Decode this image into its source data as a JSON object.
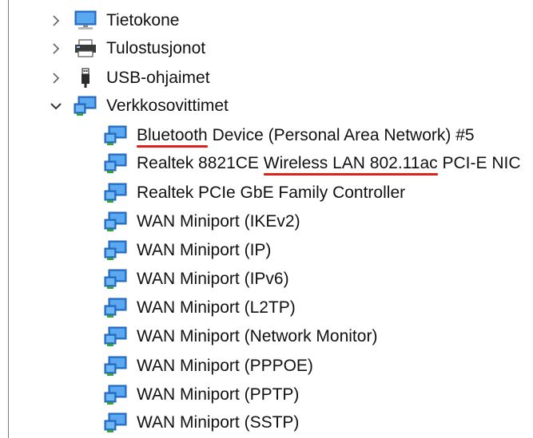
{
  "tree": {
    "categories": [
      {
        "label": "Tietokone",
        "icon": "computer-monitor-icon",
        "expanded": false
      },
      {
        "label": "Tulostusjonot",
        "icon": "printer-icon",
        "expanded": false
      },
      {
        "label": "USB-ohjaimet",
        "icon": "usb-plug-icon",
        "expanded": false
      },
      {
        "label": "Verkkosovittimet",
        "icon": "network-adapter-icon",
        "expanded": true
      }
    ],
    "adapters": [
      {
        "label": "Bluetooth Device (Personal Area Network) #5",
        "highlight_text": "Bluetooth",
        "rest_text": " Device (Personal Area Network) #5"
      },
      {
        "label": "Realtek 8821CE Wireless LAN 802.11ac PCI-E NIC",
        "pre_text": "Realtek 8821CE ",
        "highlight_text": "Wireless LAN 802.11ac",
        "rest_text": " PCI-E NIC"
      },
      {
        "label": "Realtek PCIe GbE Family Controller"
      },
      {
        "label": "WAN Miniport (IKEv2)"
      },
      {
        "label": "WAN Miniport (IP)"
      },
      {
        "label": "WAN Miniport (IPv6)"
      },
      {
        "label": "WAN Miniport (L2TP)"
      },
      {
        "label": "WAN Miniport (Network Monitor)"
      },
      {
        "label": "WAN Miniport (PPPOE)"
      },
      {
        "label": "WAN Miniport (PPTP)"
      },
      {
        "label": "WAN Miniport (SSTP)"
      }
    ],
    "adapter_icon": "network-adapter-icon",
    "annotation_color": "#e0201a"
  }
}
